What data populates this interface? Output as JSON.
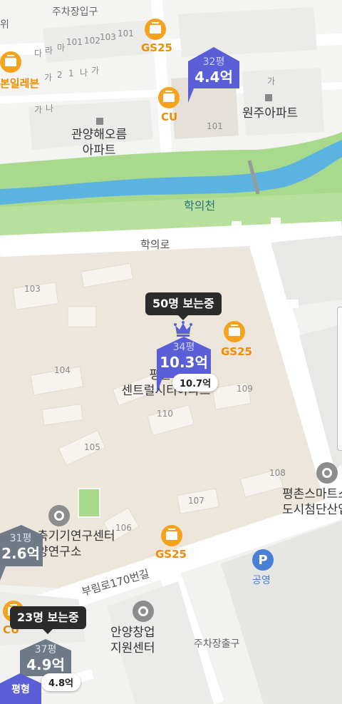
{
  "map": {
    "road_labels": [
      "학의로",
      "부림로170번길"
    ],
    "river_label": "학의천",
    "building_labels": {
      "gwanyang": "관양해오름\n아파트",
      "wonju": "원주아파트",
      "pyeongchon_central": "평촌더\n센트럴시티아파트",
      "chuckgi": "축기기연구센터\n양연구소",
      "smart": "평촌스마트스\n도시첨단산업",
      "anyang": "안양창업\n지원센터",
      "parking_entrance_top": "주차장입구",
      "parking_exit": "주차장출구",
      "public_parking": "공영",
      "bonil": "본일레븐",
      "wi": "위"
    },
    "store_labels": {
      "gs25_top": "GS25",
      "cu_top": "CU",
      "gs25_mid": "GS25",
      "gs25_bottom": "GS25",
      "cu_bottom": "CU"
    },
    "block_numbers": [
      "103",
      "104",
      "105",
      "106",
      "107",
      "108",
      "109",
      "110",
      "101",
      "102",
      "101",
      "103",
      "101"
    ],
    "small_labels": [
      "다",
      "라",
      "마",
      "가",
      "2",
      "1",
      "나",
      "가",
      "가",
      "나",
      "가"
    ]
  },
  "markers": [
    {
      "pyeong": "32평",
      "price": "4.4억",
      "color": "#5a5fd8"
    },
    {
      "pyeong": "34평",
      "price": "10.3억",
      "color": "#5a5fd8",
      "viewers": "50명 보는중",
      "chip": "10.7억",
      "has_crown": true
    },
    {
      "pyeong": "31평",
      "price": "2.6억",
      "color": "#707a86"
    },
    {
      "pyeong": "37평",
      "price": "4.9억",
      "color": "#707a86",
      "viewers": "23명 보는중",
      "chip": "4.8억"
    },
    {
      "pyeong": "평형",
      "price": "",
      "color": "#5a5fd8"
    }
  ],
  "colors": {
    "map_bg": "#f2f2f0",
    "complex_fill": "#ede6dd",
    "river": "#5cb3e0",
    "river_bank": "#a7d88b",
    "road": "#ffffff",
    "marker_blue": "#5a5fd8",
    "marker_gray": "#707a86"
  }
}
